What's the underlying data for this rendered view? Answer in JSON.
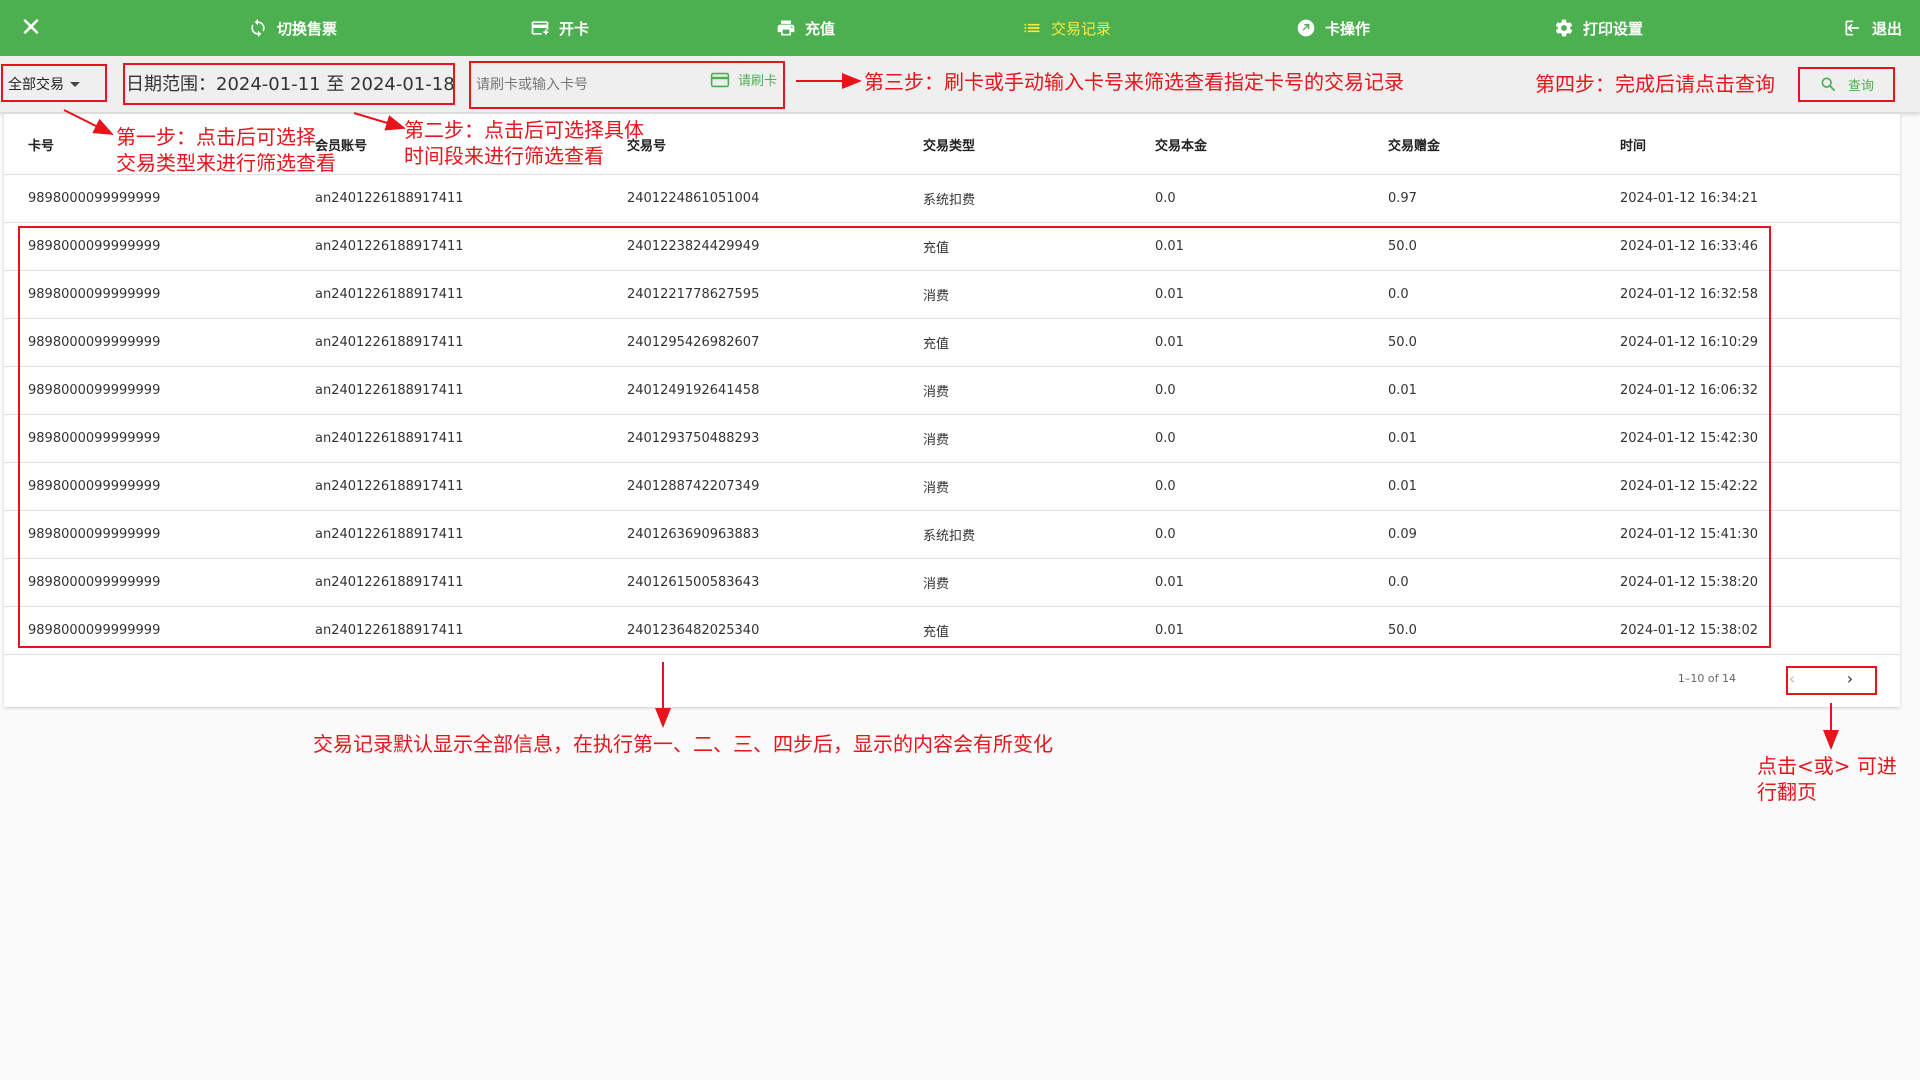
{
  "nav": {
    "close_symbol": "✕",
    "items": [
      {
        "label": "切换售票",
        "icon": "refresh-icon"
      },
      {
        "label": "开卡",
        "icon": "add-card-icon"
      },
      {
        "label": "充值",
        "icon": "printer-icon"
      },
      {
        "label": "交易记录",
        "icon": "list-icon",
        "active": true
      },
      {
        "label": "卡操作",
        "icon": "arrow-circle-icon"
      },
      {
        "label": "打印设置",
        "icon": "gear-icon"
      }
    ],
    "logout_label": "退出",
    "active_color": "#ffeb3b",
    "bar_color": "#4caf50"
  },
  "filters": {
    "type_select": "全部交易",
    "date_range": "日期范围：2024-01-11 至 2024-01-18",
    "card_placeholder": "请刷卡或输入卡号",
    "swipe_label": "请刷卡",
    "query_label": "查询"
  },
  "table": {
    "headers": [
      "卡号",
      "会员账号",
      "交易号",
      "交易类型",
      "交易本金",
      "交易赠金",
      "时间"
    ],
    "rows": [
      [
        "9898000099999999",
        "an2401226188917411",
        "2401224861051004",
        "系统扣费",
        "0.0",
        "0.97",
        "2024-01-12 16:34:21"
      ],
      [
        "9898000099999999",
        "an2401226188917411",
        "2401223824429949",
        "充值",
        "0.01",
        "50.0",
        "2024-01-12 16:33:46"
      ],
      [
        "9898000099999999",
        "an2401226188917411",
        "2401221778627595",
        "消费",
        "0.01",
        "0.0",
        "2024-01-12 16:32:58"
      ],
      [
        "9898000099999999",
        "an2401226188917411",
        "2401295426982607",
        "充值",
        "0.01",
        "50.0",
        "2024-01-12 16:10:29"
      ],
      [
        "9898000099999999",
        "an2401226188917411",
        "2401249192641458",
        "消费",
        "0.0",
        "0.01",
        "2024-01-12 16:06:32"
      ],
      [
        "9898000099999999",
        "an2401226188917411",
        "2401293750488293",
        "消费",
        "0.0",
        "0.01",
        "2024-01-12 15:42:30"
      ],
      [
        "9898000099999999",
        "an2401226188917411",
        "2401288742207349",
        "消费",
        "0.0",
        "0.01",
        "2024-01-12 15:42:22"
      ],
      [
        "9898000099999999",
        "an2401226188917411",
        "2401263690963883",
        "系统扣费",
        "0.0",
        "0.09",
        "2024-01-12 15:41:30"
      ],
      [
        "9898000099999999",
        "an2401226188917411",
        "2401261500583643",
        "消费",
        "0.01",
        "0.0",
        "2024-01-12 15:38:20"
      ],
      [
        "9898000099999999",
        "an2401226188917411",
        "2401236482025340",
        "充值",
        "0.01",
        "50.0",
        "2024-01-12 15:38:02"
      ]
    ]
  },
  "pagination": {
    "info": "1–10 of 14",
    "prev": "‹",
    "next": "›"
  },
  "annotations": {
    "color": "#e8141c",
    "step1": [
      "第一步：点击后可选择",
      "交易类型来进行筛选查看"
    ],
    "step2": [
      "第二步：点击后可选择具体",
      "时间段来进行筛选查看"
    ],
    "step3": "第三步：刷卡或手动输入卡号来筛选查看指定卡号的交易记录",
    "step4": "第四步：完成后请点击查询",
    "records_note": "交易记录默认显示全部信息，在执行第一、二、三、四步后，显示的内容会有所变化",
    "paging_note": [
      "点击<或> 可进",
      "行翻页"
    ]
  }
}
